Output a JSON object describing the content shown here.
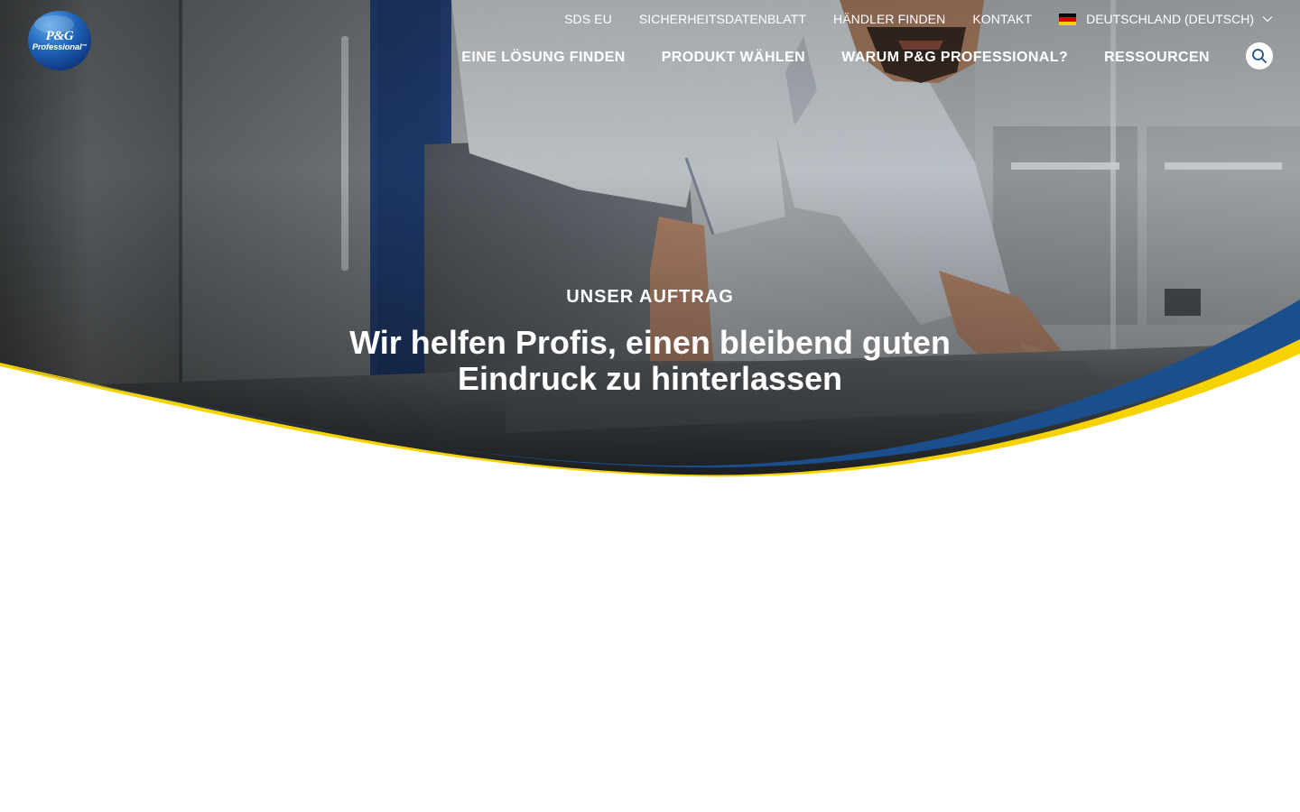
{
  "logo": {
    "brand": "P&G",
    "sub": "Professional",
    "trademark": "™"
  },
  "utility_nav": {
    "items": [
      {
        "label": "SDS EU"
      },
      {
        "label": "SICHERHEITSDATENBLATT"
      },
      {
        "label": "HÄNDLER FINDEN"
      },
      {
        "label": "KONTAKT"
      }
    ],
    "country": {
      "label": "DEUTSCHLAND (DEUTSCH)",
      "flag_icon": "germany-flag-icon",
      "flag_colors": [
        "#000000",
        "#dd0000",
        "#ffce00"
      ]
    }
  },
  "main_nav": {
    "items": [
      {
        "label": "EINE LÖSUNG FINDEN"
      },
      {
        "label": "PRODUKT WÄHLEN"
      },
      {
        "label": "WARUM P&G PROFESSIONAL?"
      },
      {
        "label": "RESSOURCEN"
      }
    ],
    "search_icon": "search-icon"
  },
  "hero": {
    "eyebrow": "UNSER AUFTRAG",
    "title_line1": "Wir helfen Profis, einen bleibend guten",
    "title_line2": "Eindruck zu hinterlassen",
    "background": "chef leaning over a stainless steel kitchen counter",
    "wave_colors": {
      "blue": "#1b4e8c",
      "yellow": "#f6d300"
    }
  },
  "colors": {
    "brand_blue": "#1b4e8c",
    "brand_yellow": "#f6d300",
    "text_on_hero": "#ffffff",
    "search_icon": "#1b4e8c"
  }
}
